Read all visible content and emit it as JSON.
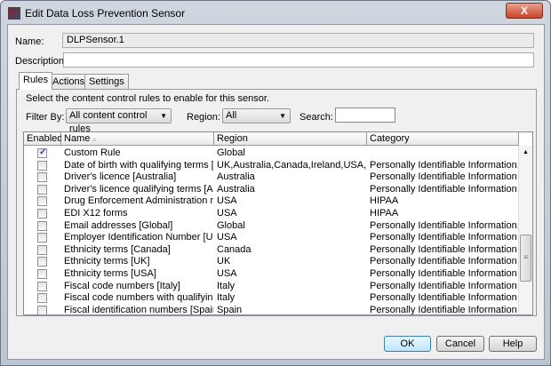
{
  "window": {
    "title": "Edit Data Loss Prevention Sensor",
    "close_label": "X"
  },
  "form": {
    "name_label": "Name:",
    "name_value": "DLPSensor.1",
    "description_label": "Description:",
    "description_value": ""
  },
  "tabs": [
    {
      "label": "Rules",
      "active": true
    },
    {
      "label": "Actions"
    },
    {
      "label": "Settings"
    }
  ],
  "rules": {
    "instruction": "Select the content control rules to enable for this sensor.",
    "filter_label": "Filter By:",
    "filter_value": "All content control rules",
    "region_label": "Region:",
    "region_value": "All",
    "search_label": "Search:",
    "search_value": "",
    "columns": [
      "Enabled",
      "Name",
      "Region",
      "Category"
    ],
    "sort_indicator": "▵",
    "rows": [
      {
        "enabled": true,
        "name": "Custom Rule",
        "region": "Global",
        "category": ""
      },
      {
        "enabled": false,
        "name": "Date of birth with qualifying terms [Glob...",
        "region": "UK,Australia,Canada,Ireland,USA,New ...",
        "category": "Personally Identifiable Information,HIPA..."
      },
      {
        "enabled": false,
        "name": "Driver's licence [Australia]",
        "region": "Australia",
        "category": "Personally Identifiable Information"
      },
      {
        "enabled": false,
        "name": "Driver's licence qualifying terms [Austr...",
        "region": "Australia",
        "category": "Personally Identifiable Information"
      },
      {
        "enabled": false,
        "name": "Drug Enforcement Administration numb...",
        "region": "USA",
        "category": "HIPAA"
      },
      {
        "enabled": false,
        "name": "EDI X12 forms",
        "region": "USA",
        "category": "HIPAA"
      },
      {
        "enabled": false,
        "name": "Email addresses [Global]",
        "region": "Global",
        "category": "Personally Identifiable Information,HIPAA"
      },
      {
        "enabled": false,
        "name": "Employer Identification Number [USA]",
        "region": "USA",
        "category": "Personally Identifiable Information"
      },
      {
        "enabled": false,
        "name": "Ethnicity terms [Canada]",
        "region": "Canada",
        "category": "Personally Identifiable Information"
      },
      {
        "enabled": false,
        "name": "Ethnicity terms [UK]",
        "region": "UK",
        "category": "Personally Identifiable Information"
      },
      {
        "enabled": false,
        "name": "Ethnicity terms [USA]",
        "region": "USA",
        "category": "Personally Identifiable Information"
      },
      {
        "enabled": false,
        "name": "Fiscal code numbers [Italy]",
        "region": "Italy",
        "category": "Personally Identifiable Information"
      },
      {
        "enabled": false,
        "name": "Fiscal code numbers with qualifying ter...",
        "region": "Italy",
        "category": "Personally Identifiable Information"
      },
      {
        "enabled": false,
        "name": "Fiscal identification numbers [Spain]",
        "region": "Spain",
        "category": "Personally Identifiable Information"
      }
    ]
  },
  "buttons": {
    "ok": "OK",
    "cancel": "Cancel",
    "help": "Help"
  }
}
